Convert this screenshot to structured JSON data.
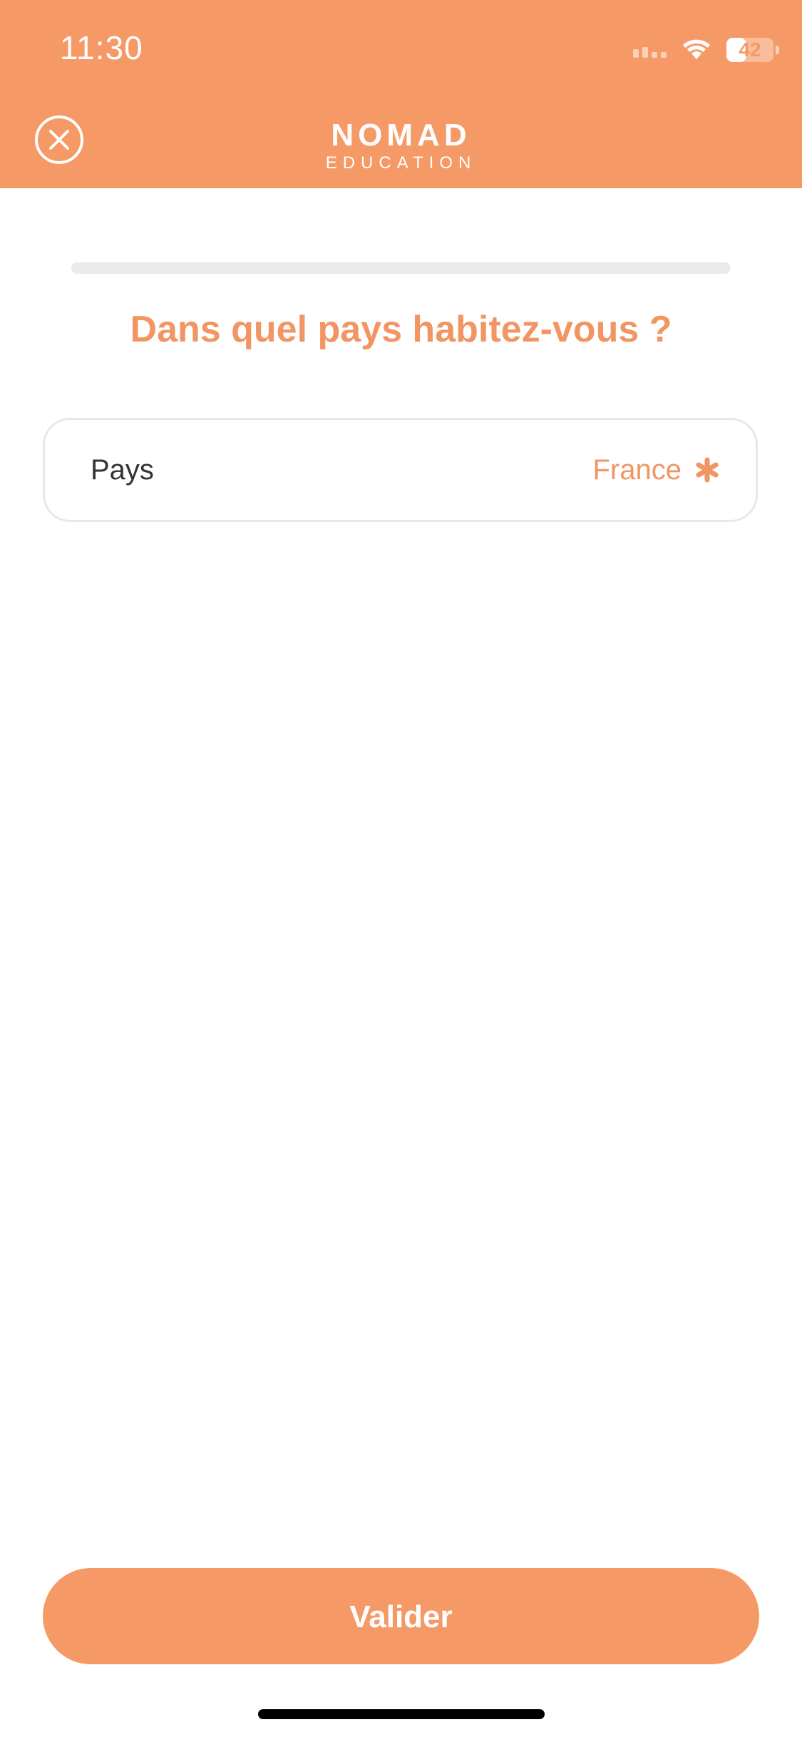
{
  "status_bar": {
    "time": "11:30",
    "battery_percent": "42",
    "battery_level": 0.42
  },
  "header": {
    "logo_main": "NOMAD",
    "logo_sub": "EDUCATION",
    "close_icon": "close-circle-icon"
  },
  "progress": {
    "value": 0
  },
  "question": {
    "title": "Dans quel pays habitez-vous ?"
  },
  "field": {
    "label": "Pays",
    "value": "France",
    "icon": "asterisk-icon"
  },
  "footer": {
    "submit_label": "Valider"
  },
  "colors": {
    "brand": "#F59A66",
    "accent_text": "#F19563",
    "track": "#EBEBEB"
  }
}
